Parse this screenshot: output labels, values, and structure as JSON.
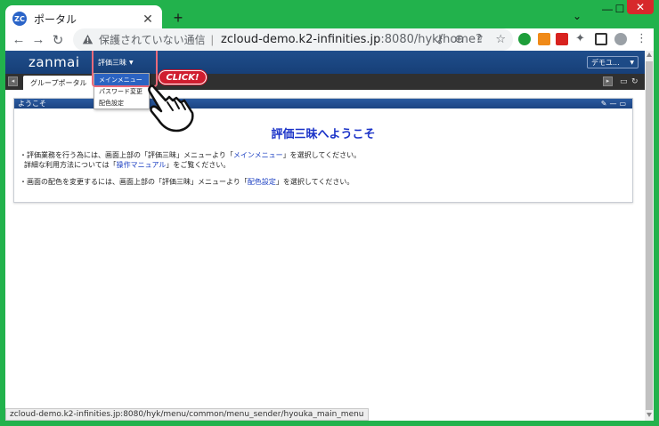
{
  "browser": {
    "tab_title": "ポータル",
    "favicon_text": "ZC",
    "new_tab": "+",
    "security_label": "保護されていない通信",
    "url_host": "zcloud-demo.k2-infinities.jp",
    "url_path": ":8080/hyk/home?",
    "status_url": "zcloud-demo.k2-infinities.jp:8080/hyk/menu/common/menu_sender/hyouka_main_menu"
  },
  "app": {
    "logo": "zanmai",
    "menu_trigger": "評価三昧",
    "user_menu": "デモユ...",
    "portal_tab": "グループポータル",
    "dropdown": [
      {
        "label": "メインメニュー"
      },
      {
        "label": "パスワード変更"
      },
      {
        "label": "配色設定"
      }
    ],
    "click_badge": "CLICK!"
  },
  "panel": {
    "header": "ようこそ",
    "welcome_title": "評価三昧へようこそ",
    "line1_pre": "・評価業務を行う為には、画面上部の「評価三昧」メニューより「",
    "line1_link": "メインメニュー",
    "line1_post": "」を選択してください。",
    "line2_pre": "詳細な利用方法については「",
    "line2_link": "操作マニュアル",
    "line2_post": "」をご覧ください。",
    "line3_pre": "・画面の配色を変更するには、画面上部の「評価三昧」メニューより「",
    "line3_link": "配色設定",
    "line3_post": "」を選択してください。"
  }
}
